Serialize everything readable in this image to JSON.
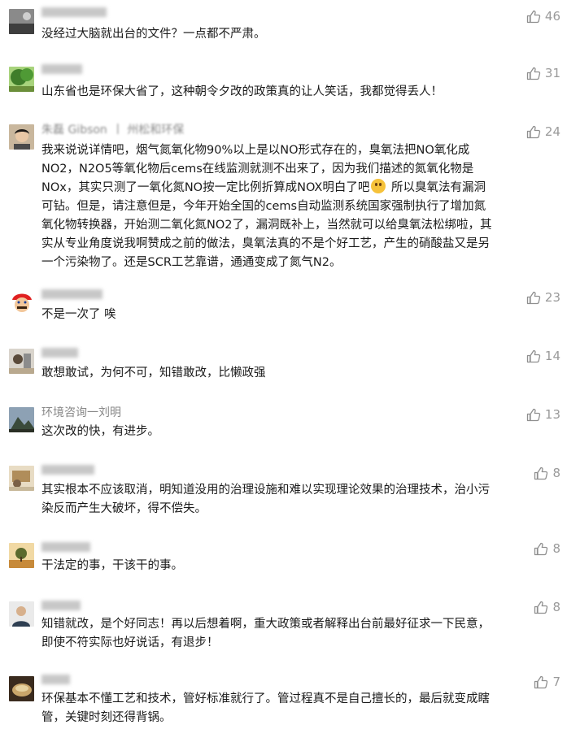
{
  "comments": [
    {
      "name": "",
      "text": "没经过大脑就出台的文件？一点都不严肃。",
      "likes": "46",
      "avatar_icon": "landscape-icon",
      "avatar_colors": [
        "#6e6e6e",
        "#d7d7d7"
      ]
    },
    {
      "name": "",
      "text": "山东省也是环保大省了，这种朝令夕改的政策真的让人笑话，我都觉得丢人！",
      "likes": "31",
      "avatar_icon": "tree-icon",
      "avatar_colors": [
        "#3f7d2a",
        "#a9d37a"
      ]
    },
    {
      "name": "朱磊 Gibson",
      "name_suffix": "丨 州松和环保",
      "text_1": "我来说说详情吧，烟气氮氧化物90%以上是以NO形式存在的，臭氧法把NO氧化成\nNO2，N2O5等氧化物后cems在线监测就测不出来了，因为我们描述的氮氧化物是\nNOx，其实只测了一氧化氮NO按一定比例折算成NOX明白了吧",
      "text_2": " 所以臭氧法有漏洞\n可钻。但是，请注意但是，今年开始全国的cems自动监测系统国家强制执行了增加氮\n氧化物转换器，开始测二氧化氮NO2了，漏洞既补上，当然就可以给臭氧法松绑啦，其\n实从专业角度说我啊赞成之前的做法，臭氧法真的不是个好工艺，产生的硝酸盐又是另\n一个污染物了。还是SCR工艺靠谱，通通变成了氮气N2。",
      "likes": "24",
      "avatar_icon": "portrait-icon",
      "emoji_icon": "grinning-face-icon"
    },
    {
      "name": "",
      "text": "不是一次了 唉",
      "likes": "23",
      "avatar_icon": "mario-icon"
    },
    {
      "name": "",
      "text": "敢想敢试，为何不可，知错敢改，比懒政强",
      "likes": "14",
      "avatar_icon": "photo-icon"
    },
    {
      "name": "环境咨询一刘明",
      "text": "这次改的快，有进步。",
      "likes": "13",
      "avatar_icon": "mountain-icon"
    },
    {
      "name": "",
      "text": "其实根本不应该取消，明知道没用的治理设施和难以实现理论效果的治理技术，治小污\n染反而产生大破坏，得不偿失。",
      "likes": "8",
      "avatar_icon": "photo-icon"
    },
    {
      "name": "",
      "text": "干法定的事，干该干的事。",
      "likes": "8",
      "avatar_icon": "sunset-tree-icon"
    },
    {
      "name": "",
      "text": "知错就改，是个好同志！再以后想着啊，重大政策或者解释出台前最好征求一下民意，\n即使不符实际也好说话，有退步！",
      "likes": "8",
      "avatar_icon": "person-icon"
    },
    {
      "name": "",
      "text": "环保基本不懂工艺和技术，管好标准就行了。管过程真不是自己擅长的，最后就变成瞎\n管，关键时刻还得背锅。",
      "likes": "7",
      "avatar_icon": "food-icon"
    }
  ]
}
